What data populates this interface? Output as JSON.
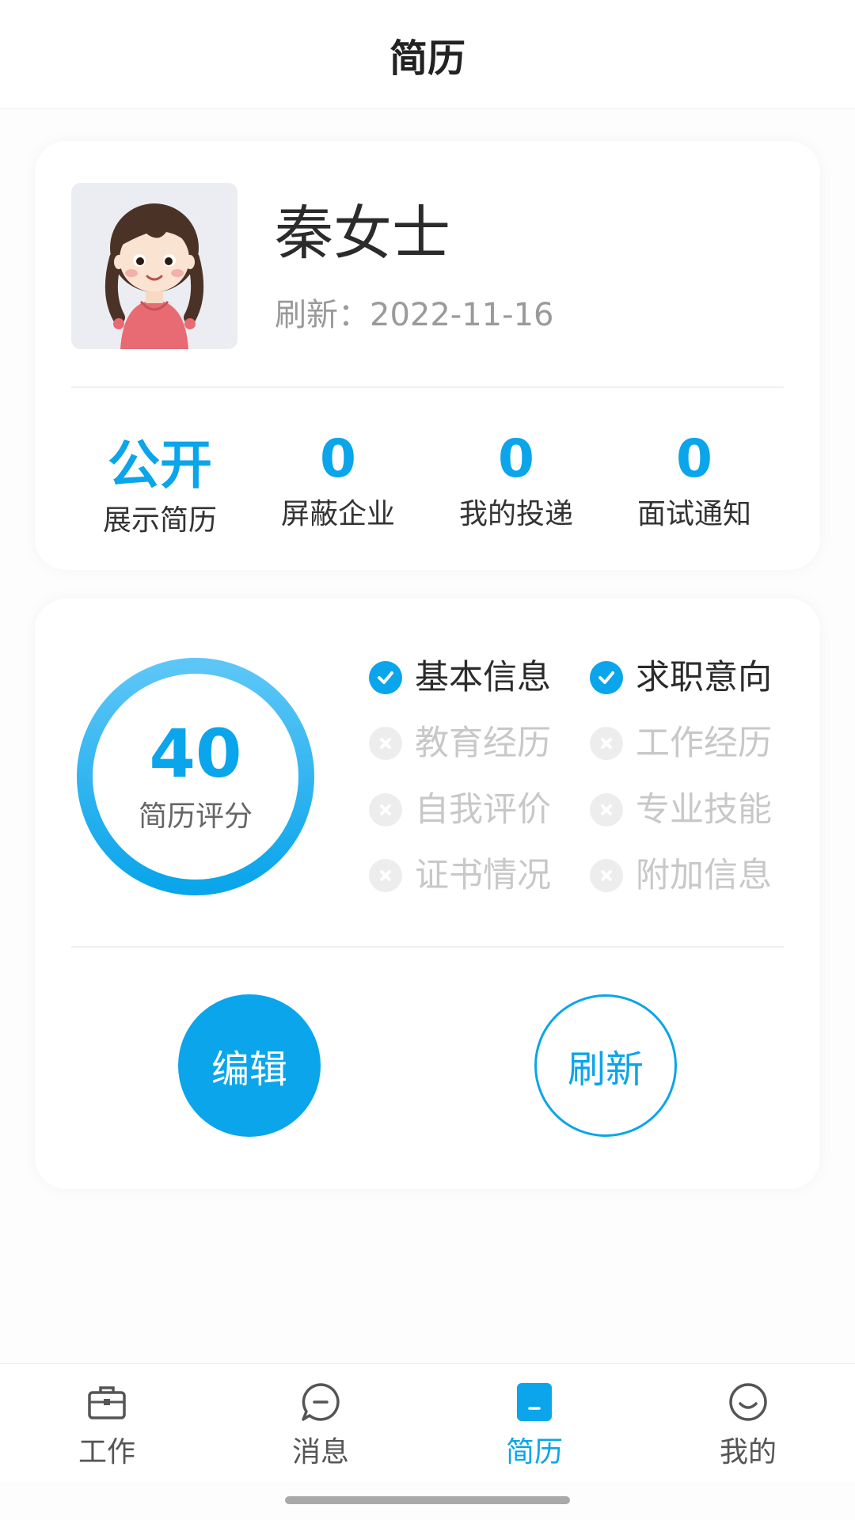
{
  "header": {
    "title": "简历"
  },
  "profile": {
    "name": "秦女士",
    "refresh_label": "刷新：",
    "refresh_date": "2022-11-16"
  },
  "stats": [
    {
      "value": "公开",
      "label": "展示简历"
    },
    {
      "value": "0",
      "label": "屏蔽企业"
    },
    {
      "value": "0",
      "label": "我的投递"
    },
    {
      "value": "0",
      "label": "面试通知"
    }
  ],
  "score": {
    "value": "40",
    "label": "简历评分",
    "progress": 1.0
  },
  "checklist": [
    {
      "label": "基本信息",
      "done": true
    },
    {
      "label": "求职意向",
      "done": true
    },
    {
      "label": "教育经历",
      "done": false
    },
    {
      "label": "工作经历",
      "done": false
    },
    {
      "label": "自我评价",
      "done": false
    },
    {
      "label": "专业技能",
      "done": false
    },
    {
      "label": "证书情况",
      "done": false
    },
    {
      "label": "附加信息",
      "done": false
    }
  ],
  "actions": {
    "edit_label": "编辑",
    "refresh_label": "刷新"
  },
  "tabbar": [
    {
      "label": "工作",
      "icon": "briefcase-icon"
    },
    {
      "label": "消息",
      "icon": "chat-bubble-icon"
    },
    {
      "label": "简历",
      "icon": "resume-icon",
      "active": true
    },
    {
      "label": "我的",
      "icon": "smiley-icon"
    }
  ],
  "colors": {
    "accent": "#0aa5ea",
    "muted": "#c8c8c8"
  }
}
